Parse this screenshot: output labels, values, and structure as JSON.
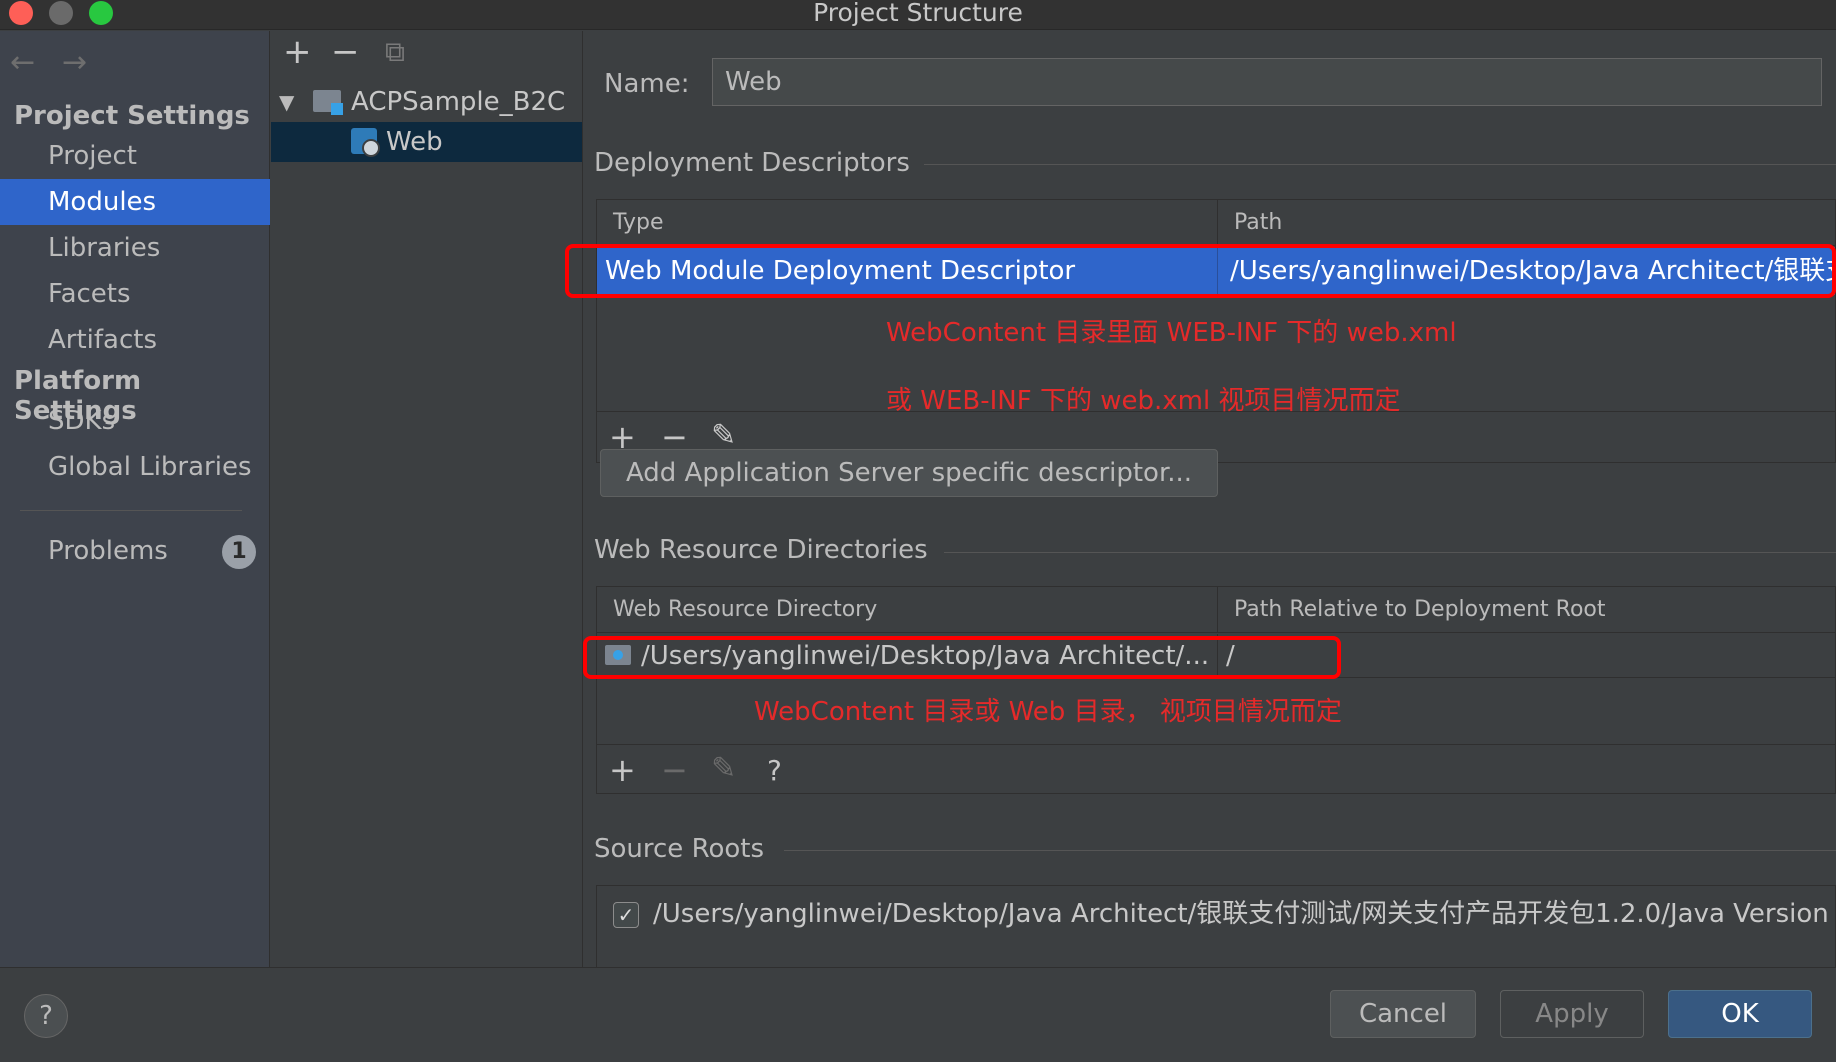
{
  "window": {
    "title": "Project Structure"
  },
  "nav": {
    "back": "←",
    "forward": "→"
  },
  "sidebar": {
    "project_settings_header": "Project Settings",
    "project_items": [
      "Project",
      "Modules",
      "Libraries",
      "Facets",
      "Artifacts"
    ],
    "platform_settings_header": "Platform Settings",
    "platform_items": [
      "SDKs",
      "Global Libraries"
    ],
    "problems_label": "Problems",
    "problems_count": "1",
    "selected": "Modules"
  },
  "tree": {
    "toolbar": {
      "add": "+",
      "remove": "−",
      "copy": "⧉"
    },
    "root": "ACPSample_B2C",
    "child": "Web"
  },
  "content": {
    "name_label": "Name:",
    "name_value": "Web",
    "deployment": {
      "title": "Deployment Descriptors",
      "col_type": "Type",
      "col_path": "Path",
      "row_type": "Web Module Deployment Descriptor",
      "row_path": "/Users/yanglinwei/Desktop/Java Architect/银联支",
      "annotation_1": "WebContent 目录里面 WEB-INF 下的 web.xml",
      "annotation_2": "或 WEB-INF 下的 web.xml 视项目情况而定",
      "add_server_button": "Add Application Server specific descriptor..."
    },
    "web_resources": {
      "title": "Web Resource Directories",
      "col_dir": "Web Resource Directory",
      "col_rel": "Path Relative to Deployment Root",
      "row_dir": "/Users/yanglinwei/Desktop/Java Architect/...",
      "row_rel": "/",
      "annotation": "WebContent 目录或 Web 目录， 视项目情况而定"
    },
    "source_roots": {
      "title": "Source Roots",
      "row_path": "/Users/yanglinwei/Desktop/Java Architect/银联支付测试/网关支付产品开发包1.2.0/Java Version",
      "checked": "✓"
    },
    "tools": {
      "add": "+",
      "remove": "−",
      "edit": "✎",
      "help": "?"
    }
  },
  "footer": {
    "help": "?",
    "cancel": "Cancel",
    "apply": "Apply",
    "ok": "OK"
  },
  "colors": {
    "selection": "#2f65ca",
    "annotation": "#e52a2a",
    "highlight_box": "#ff0000",
    "ok_button": "#365880"
  }
}
